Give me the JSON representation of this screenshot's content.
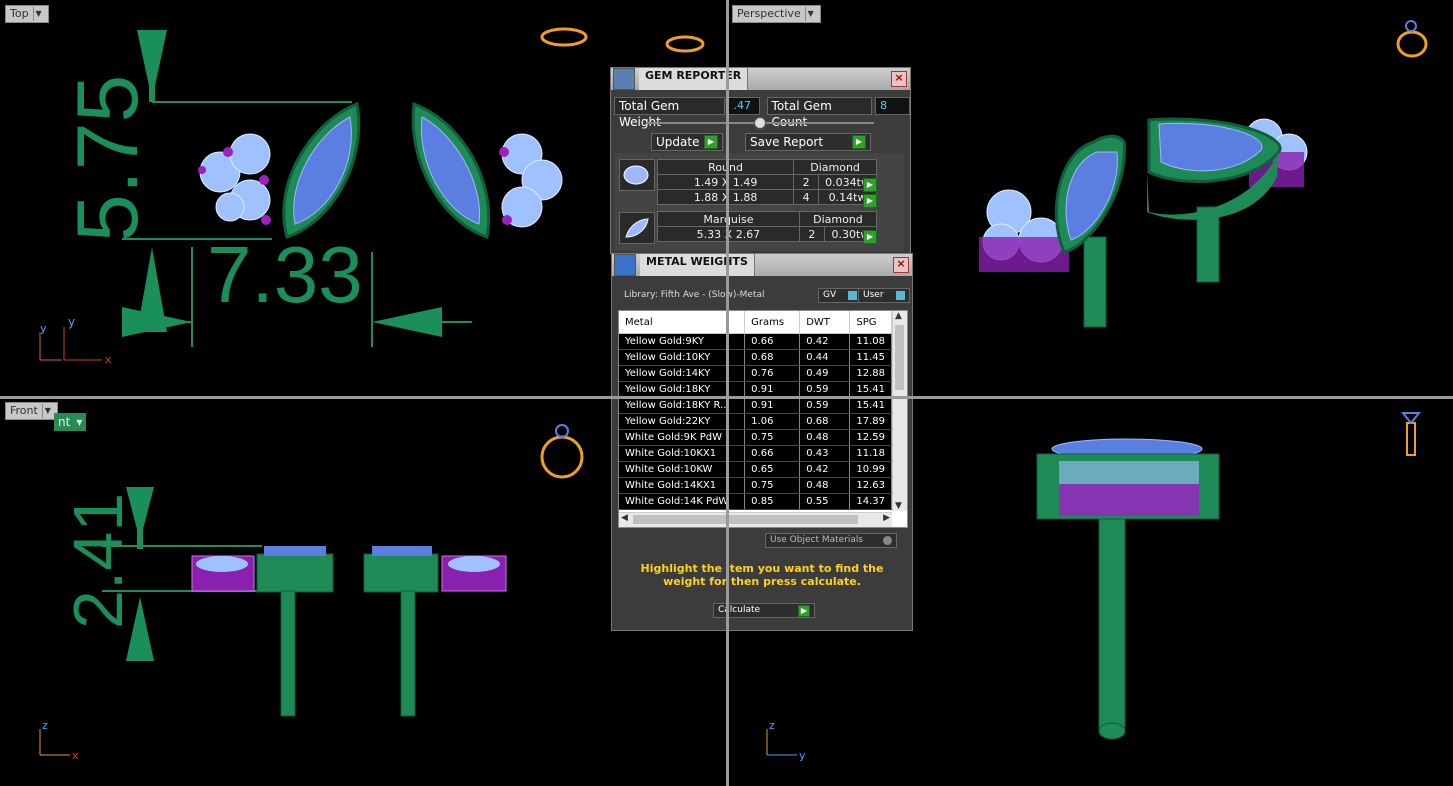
{
  "viewports": {
    "top_label": "Top",
    "perspective_label": "Perspective",
    "front_label": "Front",
    "front_partial_label": "nt"
  },
  "dimensions": {
    "height_top": "5.75",
    "width_top": "7.33",
    "height_front": "2.41"
  },
  "axes": {
    "x": "x",
    "y": "y",
    "z": "z"
  },
  "gem_reporter": {
    "title": "GEM REPORTER",
    "total_weight_label": "Total Gem Weight",
    "total_weight_value": ".47",
    "total_count_label": "Total Gem Count",
    "total_count_value": "8",
    "update_label": "Update",
    "save_label": "Save Report",
    "gems": [
      {
        "shape": "Round",
        "material": "Diamond",
        "rows": [
          {
            "size": "1.49 X 1.49",
            "count": "2",
            "weight": "0.034tw"
          },
          {
            "size": "1.88 X 1.88",
            "count": "4",
            "weight": "0.14tw"
          }
        ]
      },
      {
        "shape": "Marquise",
        "material": "Diamond",
        "rows": [
          {
            "size": "5.33 X 2.67",
            "count": "2",
            "weight": "0.30tw"
          }
        ]
      }
    ]
  },
  "metal_weights": {
    "title": "METAL WEIGHTS",
    "library": "Library: Fifth Ave - (Slow)-Metal",
    "gv_label": "GV",
    "user_label": "User",
    "columns": [
      "Metal",
      "Grams",
      "DWT",
      "SPG"
    ],
    "rows": [
      [
        "Yellow Gold:9KY",
        "0.66",
        "0.42",
        "11.08"
      ],
      [
        "Yellow Gold:10KY",
        "0.68",
        "0.44",
        "11.45"
      ],
      [
        "Yellow Gold:14KY",
        "0.76",
        "0.49",
        "12.88"
      ],
      [
        "Yellow Gold:18KY",
        "0.91",
        "0.59",
        "15.41"
      ],
      [
        "Yellow Gold:18KY R...",
        "0.91",
        "0.59",
        "15.41"
      ],
      [
        "Yellow Gold:22KY",
        "1.06",
        "0.68",
        "17.89"
      ],
      [
        "White Gold:9K PdW",
        "0.75",
        "0.48",
        "12.59"
      ],
      [
        "White Gold:10KX1",
        "0.66",
        "0.43",
        "11.18"
      ],
      [
        "White Gold:10KW",
        "0.65",
        "0.42",
        "10.99"
      ],
      [
        "White Gold:14KX1",
        "0.75",
        "0.48",
        "12.63"
      ],
      [
        "White Gold:14K PdW",
        "0.85",
        "0.55",
        "14.37"
      ]
    ],
    "use_object_materials": "Use Object Materials",
    "instruction": "Highlight the item you want to find the weight for then press calculate.",
    "calculate_label": "Calculate"
  }
}
